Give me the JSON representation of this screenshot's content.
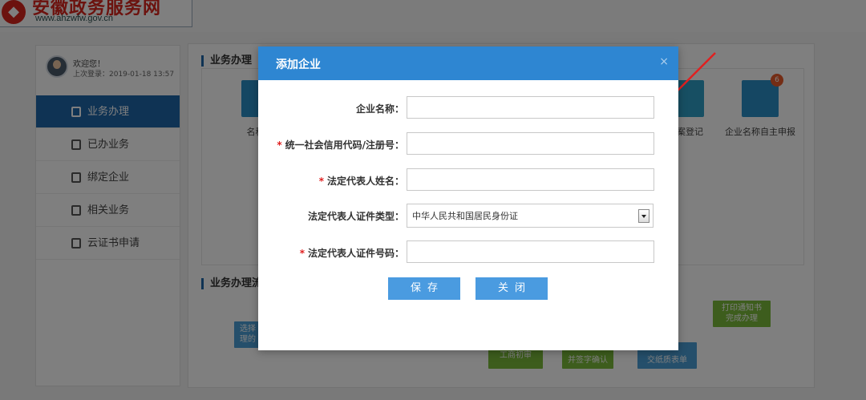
{
  "header": {
    "logo_text": "安徽政务服务网",
    "logo_url": "www.ahzwfw.gov.cn"
  },
  "user": {
    "welcome": "欢迎您！",
    "last_login": "上次登录：2019-01-18 13:57"
  },
  "sidebar": {
    "items": [
      {
        "label": "业务办理",
        "icon": "briefcase-icon",
        "active": true
      },
      {
        "label": "已办业务",
        "icon": "document-check-icon",
        "active": false
      },
      {
        "label": "绑定企业",
        "icon": "building-icon",
        "active": false
      },
      {
        "label": "相关业务",
        "icon": "list-icon",
        "active": false
      },
      {
        "label": "云证书申请",
        "icon": "certificate-icon",
        "active": false
      }
    ]
  },
  "main": {
    "section_business": "业务办理",
    "section_flow": "业务办理流",
    "services": [
      {
        "label": "名称预",
        "icon": "clipboard-icon"
      },
      {
        "label": "备案登记",
        "icon": "stamp-icon"
      },
      {
        "label": "企业名称自主申报",
        "icon": "office-building-icon",
        "badge": "6"
      }
    ],
    "flow_steps": [
      {
        "label": "选择\n理的",
        "color": "blue"
      },
      {
        "label": "打印通知书\n完成办理",
        "color": "green"
      },
      {
        "label": "工商初审",
        "color": "green"
      },
      {
        "label": "并签字确认",
        "color": "green"
      },
      {
        "label": "交纸质表单",
        "color": "blue"
      }
    ]
  },
  "dialog": {
    "title": "添加企业",
    "close_icon": "close-icon",
    "fields": {
      "company_name": {
        "label": "企业名称：",
        "required": false,
        "value": ""
      },
      "credit_code": {
        "label": "统一社会信用代码/注册号：",
        "required": true,
        "value": ""
      },
      "legal_rep_name": {
        "label": "法定代表人姓名：",
        "required": true,
        "value": ""
      },
      "id_type": {
        "label": "法定代表人证件类型：",
        "required": false,
        "value": "中华人民共和国居民身份证"
      },
      "id_number": {
        "label": "法定代表人证件号码：",
        "required": true,
        "value": ""
      }
    },
    "required_mark": "*",
    "save_label": "保存",
    "close_label": "关闭"
  },
  "colors": {
    "brand_red": "#d9251c",
    "nav_active": "#1f66a9",
    "dialog_header": "#2e86d2",
    "button": "#4a9be0",
    "required": "#e02020",
    "annotation_arrow": "#e02020"
  }
}
